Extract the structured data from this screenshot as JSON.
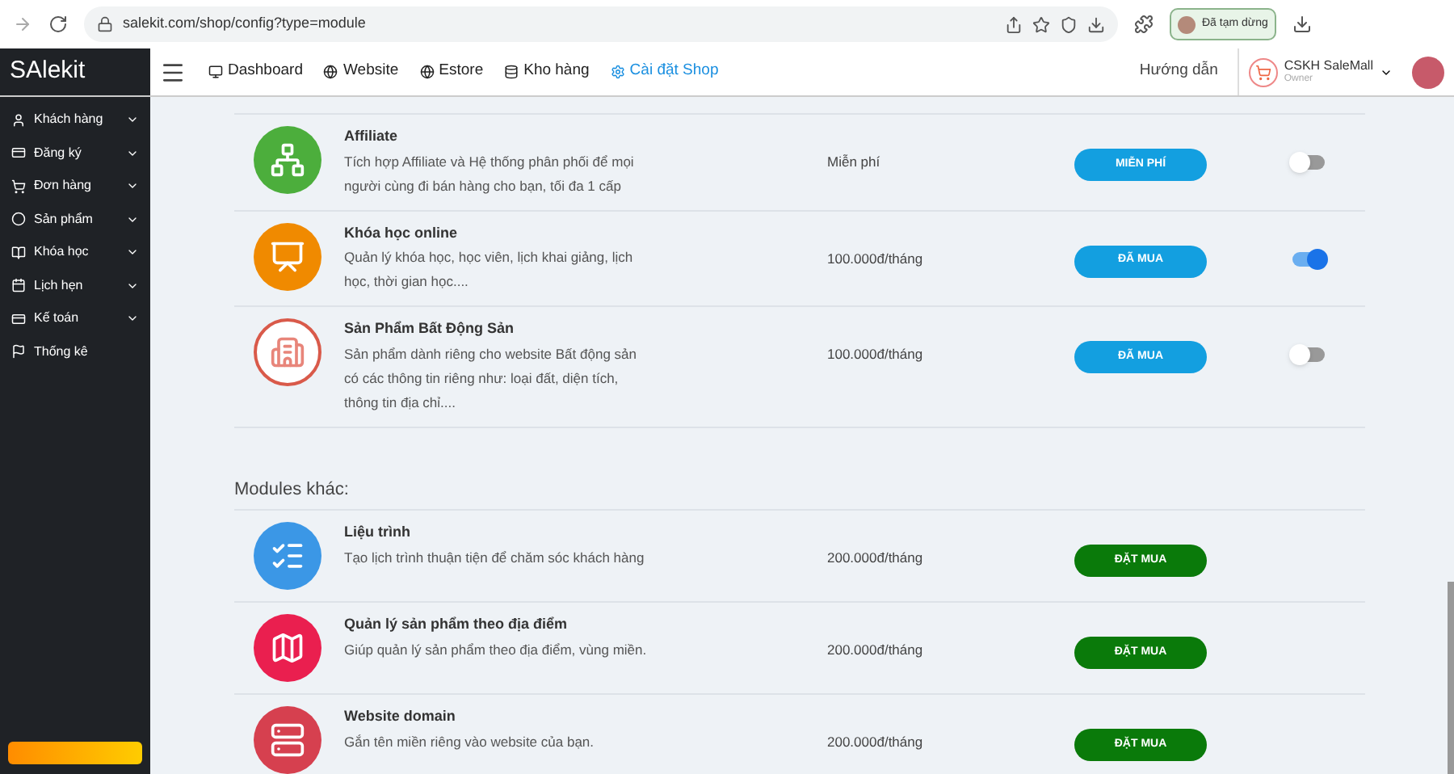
{
  "browser": {
    "url": "salekit.com/shop/config?type=module",
    "profile": "Đã tạm dừng"
  },
  "logo": "SAlekit",
  "nav": [
    {
      "label": "Dashboard",
      "selected": false
    },
    {
      "label": "Website",
      "selected": false
    },
    {
      "label": "Estore",
      "selected": false
    },
    {
      "label": "Kho hàng",
      "selected": false
    },
    {
      "label": "Cài đặt Shop",
      "selected": true
    }
  ],
  "help": "Hướng dẫn",
  "account": {
    "name": "CSKH SaleMall",
    "role": "Owner"
  },
  "sidebar": [
    {
      "label": "Khách hàng",
      "kind": "group"
    },
    {
      "label": "Đăng ký",
      "kind": "group"
    },
    {
      "label": "Đơn hàng",
      "kind": "group"
    },
    {
      "label": "Sản phẩm",
      "kind": "group"
    },
    {
      "label": "Khóa học",
      "kind": "group"
    },
    {
      "label": "Lịch hẹn",
      "kind": "group"
    },
    {
      "label": "Kế toán",
      "kind": "group"
    },
    {
      "label": "Thống kê",
      "kind": "link"
    }
  ],
  "installed": [
    {
      "name": "Affiliate",
      "description": "Tích hợp Affiliate và Hệ thống phân phối để mọi người cùng đi bán hàng cho bạn, tối đa 1 cấp",
      "price": "Miễn phí",
      "button": "MIỄN PHÍ",
      "on": false,
      "color": "#4cae3c",
      "kind": "network"
    },
    {
      "name": "Khóa học online",
      "description": "Quản lý khóa học, học viên, lịch khai giảng, lịch học, thời gian học....",
      "price": "100.000đ/tháng",
      "button": "ĐÃ MUA",
      "on": true,
      "color": "#f08a00",
      "kind": "teacher"
    },
    {
      "name": "Sản Phẩm Bất Động Sản",
      "description": "Sản phẩm dành riêng cho website Bất động sản có các thông tin riêng như: loại đất, diện tích, thông tin địa chỉ....",
      "price": "100.000đ/tháng",
      "button": "ĐÃ MUA",
      "on": false,
      "color": "#ffffff",
      "kind": "building"
    }
  ],
  "other_title": "Modules khác:",
  "others": [
    {
      "name": "Liệu trình",
      "description": "Tạo lịch trình thuận tiện để chăm sóc khách hàng",
      "price": "200.000đ/tháng",
      "button": "ĐẶT MUA",
      "color": "#3b97e6",
      "kind": "checklist"
    },
    {
      "name": "Quản lý sản phẩm theo địa điểm",
      "description": "Giúp quản lý sản phẩm theo địa điểm, vùng miền.",
      "price": "200.000đ/tháng",
      "button": "ĐẶT MUA",
      "color": "#ea1f4f",
      "kind": "map"
    },
    {
      "name": "Website domain",
      "description": "Gắn tên miền riêng vào website của bạn.",
      "price": "200.000đ/tháng",
      "button": "ĐẶT MUA",
      "color": "#d6404f",
      "kind": "domain"
    }
  ]
}
